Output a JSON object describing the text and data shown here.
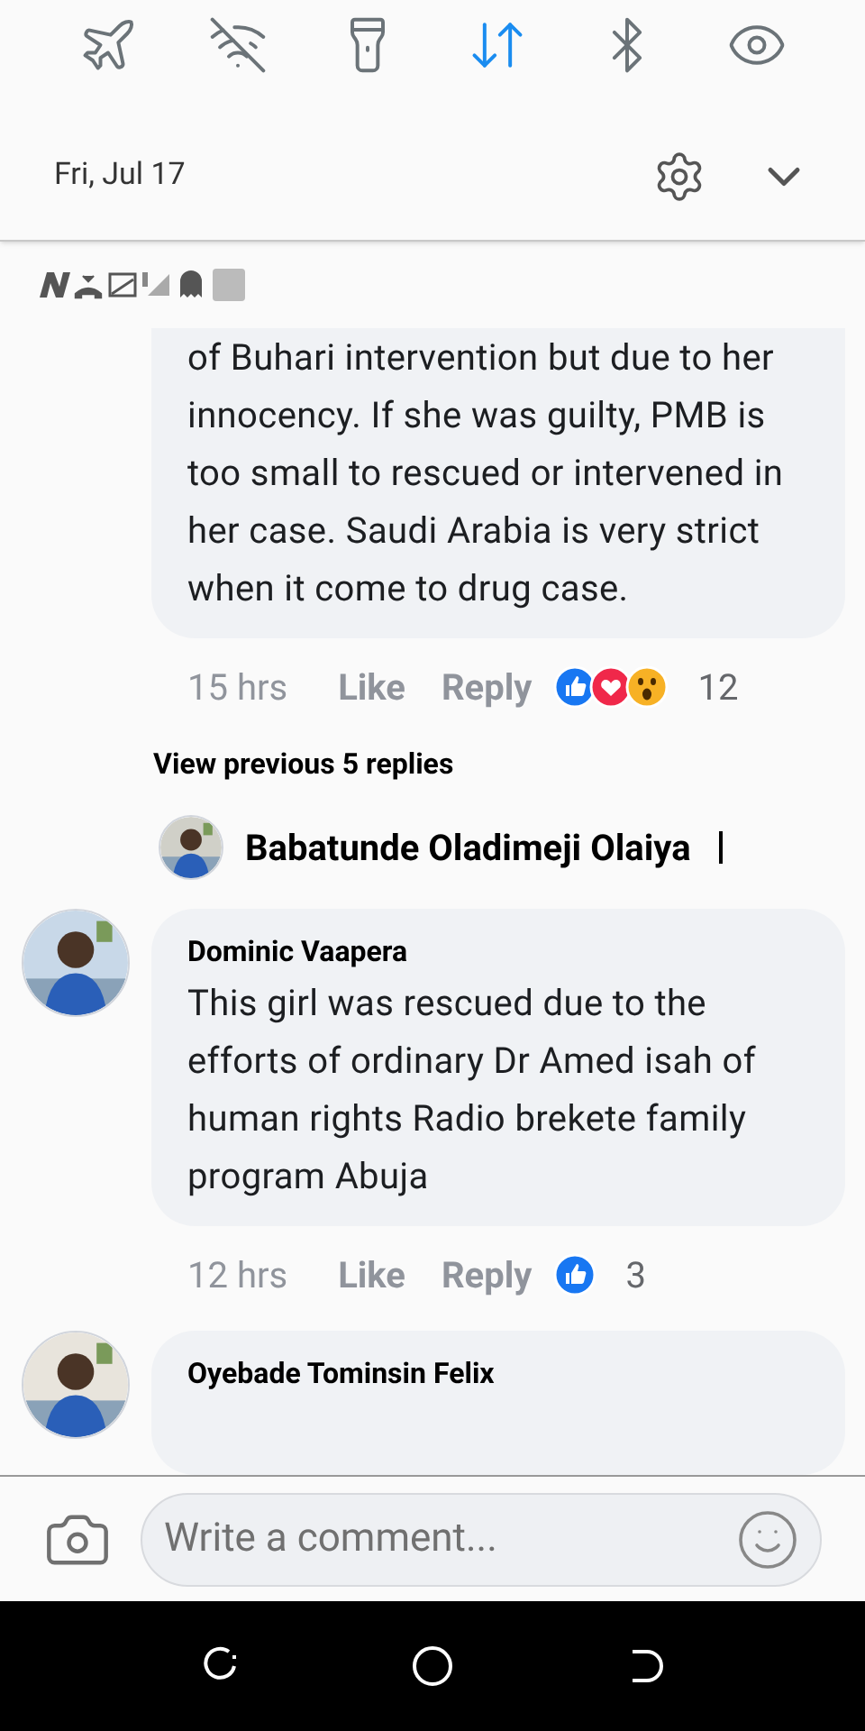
{
  "quick_toggles": [
    {
      "kind": "airplane",
      "on": false
    },
    {
      "kind": "wifi",
      "on": false
    },
    {
      "kind": "flashlight",
      "on": false
    },
    {
      "kind": "data",
      "on": true
    },
    {
      "kind": "bluetooth",
      "on": false
    },
    {
      "kind": "eye",
      "on": false
    }
  ],
  "date": "Fri, Jul 17",
  "comments": [
    {
      "text": "of Buhari intervention but due to her innocency. If she was guilty, PMB is too small to rescued or intervened in her case. Saudi Arabia is very strict when it come to drug case.",
      "time": "15 hrs",
      "like": "Like",
      "reply": "Reply",
      "reactions": [
        {
          "kind": "like"
        },
        {
          "kind": "love"
        },
        {
          "kind": "wow"
        }
      ],
      "reaction_count": "12"
    },
    {
      "kind": "view_more",
      "text": "View previous 5 replies"
    },
    {
      "kind": "reply_preview",
      "author": "Babatunde Oladimeji Olaiya"
    },
    {
      "author": "Dominic Vaapera",
      "text": "This girl was rescued due to the efforts of ordinary Dr Amed isah of human rights Radio brekete family program Abuja",
      "time": "12 hrs",
      "like": "Like",
      "reply": "Reply",
      "reactions": [
        {
          "kind": "like"
        }
      ],
      "reaction_count": "3"
    },
    {
      "author": "Oyebade Tominsin Felix"
    }
  ],
  "composer": {
    "placeholder": "Write a comment..."
  }
}
